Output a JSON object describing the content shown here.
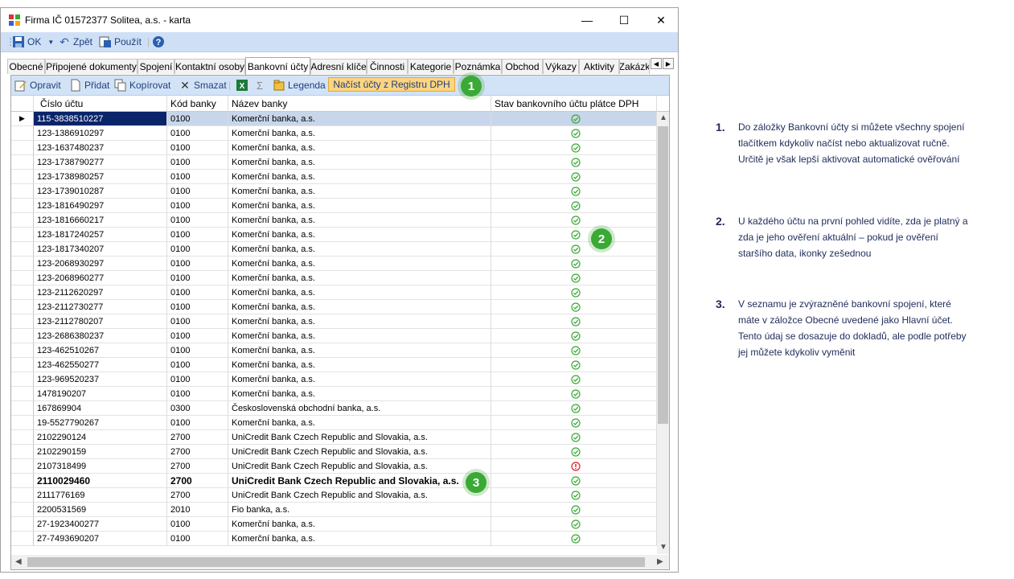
{
  "window": {
    "title": "Firma IČ 01572377 Solitea, a.s. - karta",
    "minimize": "—",
    "maximize": "☐",
    "close": "✕"
  },
  "toolbar": {
    "ok": "OK",
    "back": "Zpět",
    "apply": "Použít"
  },
  "tabs": [
    "Obecné",
    "Připojené dokumenty",
    "Spojení",
    "Kontaktní osoby",
    "Bankovní účty",
    "Adresní klíče",
    "Činnosti",
    "Kategorie",
    "Poznámka",
    "Obchod",
    "Výkazy",
    "Aktivity",
    "Zakázk"
  ],
  "active_tab": "Bankovní účty",
  "sub_toolbar": {
    "edit": "Opravit",
    "add": "Přidat",
    "copy": "Kopírovat",
    "delete": "Smazat",
    "legend": "Legenda",
    "load_registry": "Načíst účty z Registru DPH"
  },
  "columns": [
    "Číslo účtu",
    "Kód banky",
    "Název banky",
    "Stav bankovního účtu plátce DPH"
  ],
  "rows": [
    {
      "account": "115-3838510227",
      "code": "0100",
      "bank": "Komerční banka, a.s.",
      "status": "ok"
    },
    {
      "account": "123-1386910297",
      "code": "0100",
      "bank": "Komerční banka, a.s.",
      "status": "ok"
    },
    {
      "account": "123-1637480237",
      "code": "0100",
      "bank": "Komerční banka, a.s.",
      "status": "ok"
    },
    {
      "account": "123-1738790277",
      "code": "0100",
      "bank": "Komerční banka, a.s.",
      "status": "ok"
    },
    {
      "account": "123-1738980257",
      "code": "0100",
      "bank": "Komerční banka, a.s.",
      "status": "ok"
    },
    {
      "account": "123-1739010287",
      "code": "0100",
      "bank": "Komerční banka, a.s.",
      "status": "ok"
    },
    {
      "account": "123-1816490297",
      "code": "0100",
      "bank": "Komerční banka, a.s.",
      "status": "ok"
    },
    {
      "account": "123-1816660217",
      "code": "0100",
      "bank": "Komerční banka, a.s.",
      "status": "ok"
    },
    {
      "account": "123-1817240257",
      "code": "0100",
      "bank": "Komerční banka, a.s.",
      "status": "ok"
    },
    {
      "account": "123-1817340207",
      "code": "0100",
      "bank": "Komerční banka, a.s.",
      "status": "ok"
    },
    {
      "account": "123-2068930297",
      "code": "0100",
      "bank": "Komerční banka, a.s.",
      "status": "ok"
    },
    {
      "account": "123-2068960277",
      "code": "0100",
      "bank": "Komerční banka, a.s.",
      "status": "ok"
    },
    {
      "account": "123-2112620297",
      "code": "0100",
      "bank": "Komerční banka, a.s.",
      "status": "ok"
    },
    {
      "account": "123-2112730277",
      "code": "0100",
      "bank": "Komerční banka, a.s.",
      "status": "ok"
    },
    {
      "account": "123-2112780207",
      "code": "0100",
      "bank": "Komerční banka, a.s.",
      "status": "ok"
    },
    {
      "account": "123-2686380237",
      "code": "0100",
      "bank": "Komerční banka, a.s.",
      "status": "ok"
    },
    {
      "account": "123-462510267",
      "code": "0100",
      "bank": "Komerční banka, a.s.",
      "status": "ok"
    },
    {
      "account": "123-462550277",
      "code": "0100",
      "bank": "Komerční banka, a.s.",
      "status": "ok"
    },
    {
      "account": "123-969520237",
      "code": "0100",
      "bank": "Komerční banka, a.s.",
      "status": "ok"
    },
    {
      "account": "1478190207",
      "code": "0100",
      "bank": "Komerční banka, a.s.",
      "status": "ok"
    },
    {
      "account": "167869904",
      "code": "0300",
      "bank": "Československá obchodní banka, a.s.",
      "status": "ok"
    },
    {
      "account": "19-5527790267",
      "code": "0100",
      "bank": "Komerční banka, a.s.",
      "status": "ok"
    },
    {
      "account": "2102290124",
      "code": "2700",
      "bank": "UniCredit Bank Czech Republic and Slovakia, a.s.",
      "status": "ok"
    },
    {
      "account": "2102290159",
      "code": "2700",
      "bank": "UniCredit Bank Czech Republic and Slovakia, a.s.",
      "status": "ok"
    },
    {
      "account": "2107318499",
      "code": "2700",
      "bank": "UniCredit Bank Czech Republic and Slovakia, a.s.",
      "status": "warn"
    },
    {
      "account": "2110029460",
      "code": "2700",
      "bank": "UniCredit Bank Czech Republic and Slovakia, a.s.",
      "status": "ok",
      "bold": true
    },
    {
      "account": "2111776169",
      "code": "2700",
      "bank": "UniCredit Bank Czech Republic and Slovakia, a.s.",
      "status": "ok"
    },
    {
      "account": "2200531569",
      "code": "2010",
      "bank": "Fio banka, a.s.",
      "status": "ok"
    },
    {
      "account": "27-1923400277",
      "code": "0100",
      "bank": "Komerční banka, a.s.",
      "status": "ok"
    },
    {
      "account": "27-7493690207",
      "code": "0100",
      "bank": "Komerční banka, a.s.",
      "status": "ok"
    }
  ],
  "badges": [
    "1",
    "2",
    "3"
  ],
  "notes": [
    {
      "num": "1.",
      "text": "Do záložky Bankovní účty si můžete všechny spojení tlačítkem kdykoliv načíst nebo aktualizovat ručně. Určitě je však lepší aktivovat automatické ověřování"
    },
    {
      "num": "2.",
      "text": "U každého účtu na první pohled vidíte, zda je platný a zda je jeho ověření aktuální – pokud je ověření staršího data, ikonky zešednou"
    },
    {
      "num": "3.",
      "text": "V seznamu je zvýrazněné bankovní spojení, které máte v záložce Obecné uvedené jako Hlavní účet. Tento údaj se dosazuje do dokladů, ale podle potřeby jej můžete kdykoliv vyměnit"
    }
  ],
  "colors": {
    "ok": "#3aa935",
    "warn": "#e02020",
    "badge": "#3aa935",
    "note_text": "#1f2b5a"
  }
}
